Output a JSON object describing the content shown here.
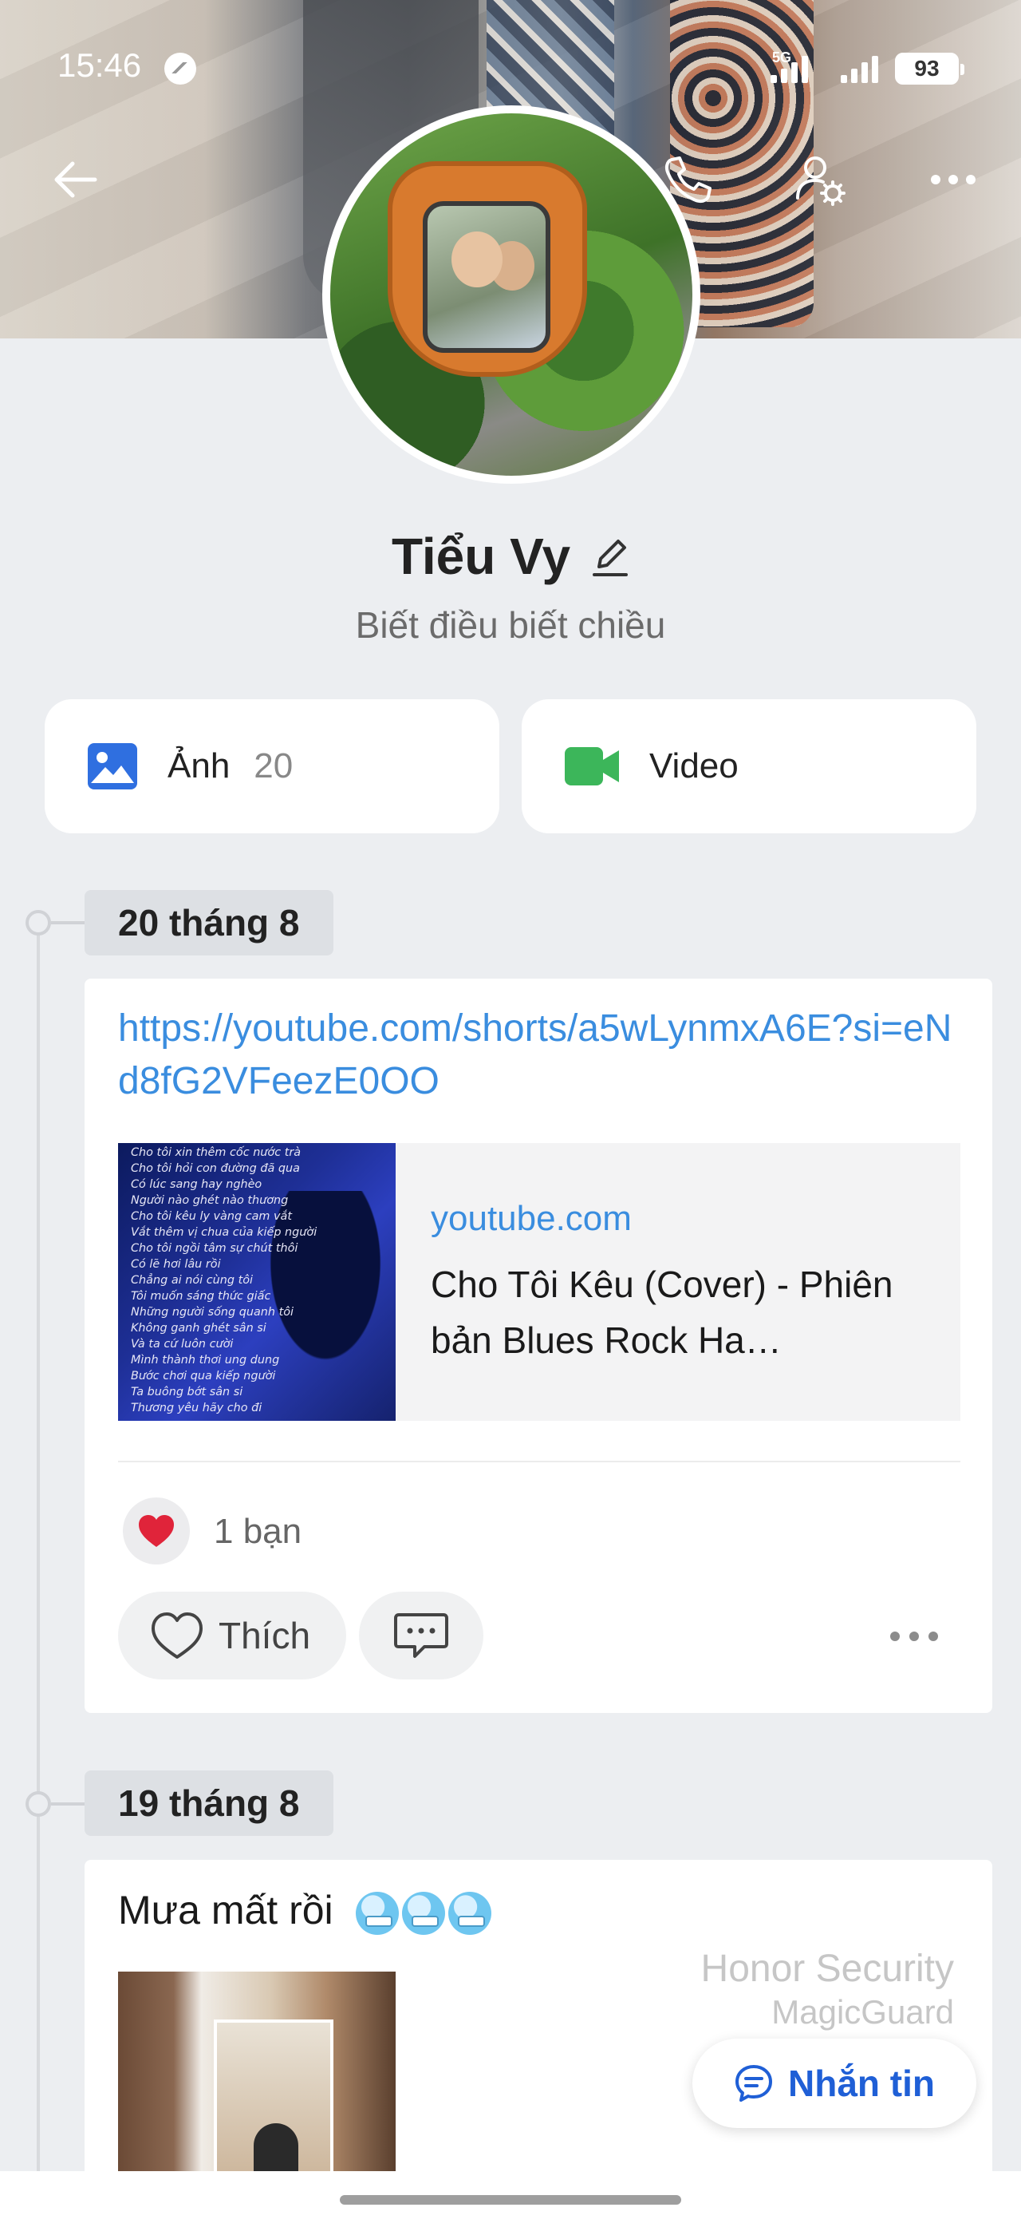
{
  "status_bar": {
    "time": "15:46",
    "network": "5G",
    "battery": "93"
  },
  "profile": {
    "name": "Tiểu Vy",
    "bio": "Biết điều biết chiều"
  },
  "media_tiles": {
    "photos_label": "Ảnh",
    "photos_count": "20",
    "video_label": "Video"
  },
  "posts": [
    {
      "date": "20 tháng 8",
      "link": "https://youtube.com/shorts/a5wLynmxA6E?si=eNd8fG2VFeezE0OO",
      "preview": {
        "domain": "youtube.com",
        "title": "Cho Tôi Kêu (Cover) - Phiên bản Blues Rock Ha…",
        "thumbnail_lyrics": "Cho tôi xin thêm cốc nước trà\nCho tôi hỏi con đường đã qua\nCó lúc sang hay nghèo\nNgười nào ghét nào thương\nCho tôi kêu ly vàng cam vắt\nVắt thêm vị chua của kiếp người\nCho tôi ngồi tâm sự chút thôi\nCó lẽ hơi lâu rồi\nChẳng ai nói cùng tôi\nTôi muốn sáng thức giấc\nNhững người sống quanh tôi\nKhông ganh ghét sân si\nVà ta cứ luôn cười\nMình thành thơi ung dung\nBước chơi qua kiếp người\nTa buông bớt sân si\nThương yêu hãy cho đi"
      },
      "reactions_text": "1 bạn",
      "like_label": "Thích"
    },
    {
      "date": "19 tháng 8",
      "text": "Mưa mất rồi"
    }
  ],
  "watermark": {
    "line1": "Honor Security",
    "line2": "MagicGuard"
  },
  "fab": {
    "label": "Nhắn tin"
  },
  "colors": {
    "link": "#3a8ddf",
    "fab_text": "#1f5fd6",
    "photo_icon": "#2f6fe0",
    "video_icon": "#3cb65a",
    "heart": "#e0243a"
  },
  "icons": [
    "back-arrow-icon",
    "phone-icon",
    "user-settings-icon",
    "more-icon",
    "edit-icon",
    "photo-icon",
    "video-icon",
    "heart-icon",
    "comment-icon",
    "chat-icon"
  ]
}
